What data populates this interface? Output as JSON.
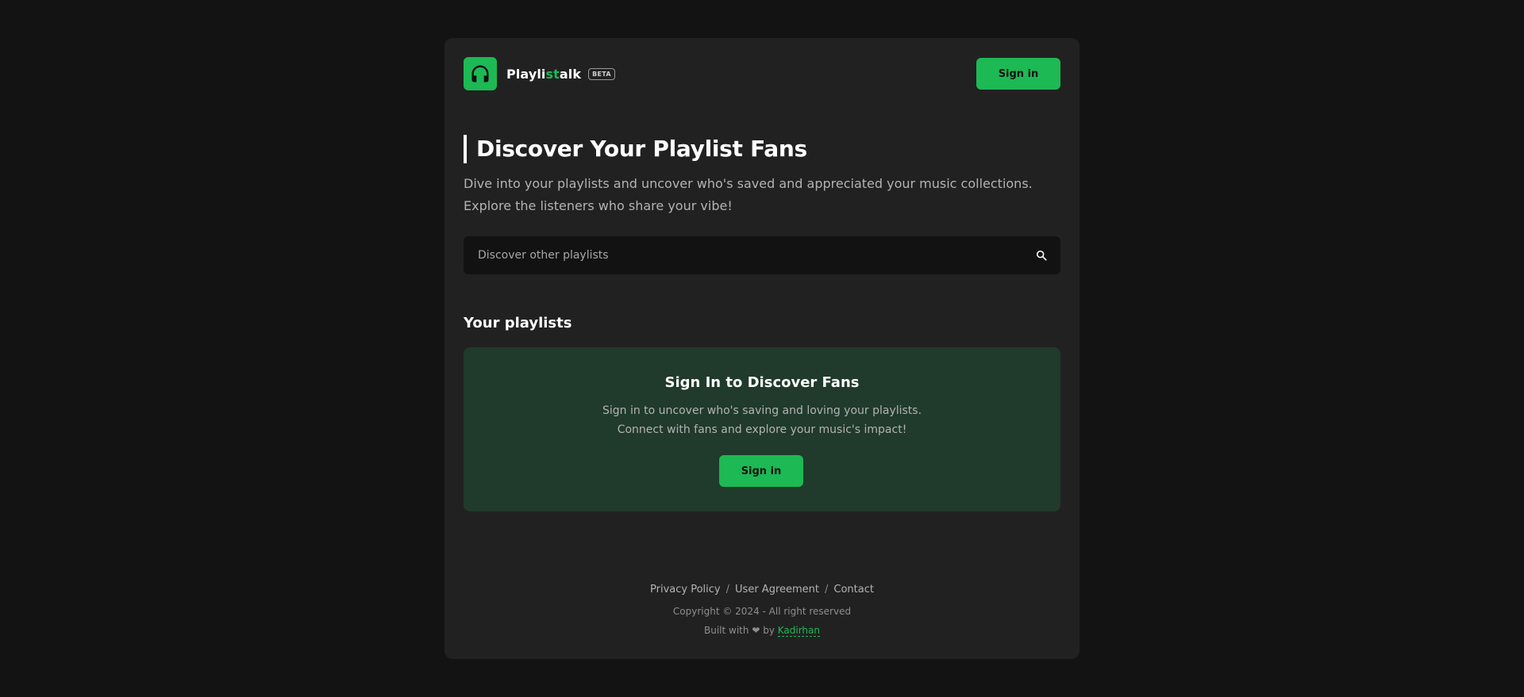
{
  "colors": {
    "page_background": "#131313",
    "card_background": "#212121",
    "accent": "#1db954",
    "panel_background": "#203a2b",
    "search_background": "#121212",
    "muted_text": "#b3b3b3"
  },
  "header": {
    "brand_prefix": "Playli",
    "brand_accent": "st",
    "brand_suffix": "alk",
    "badge": "BETA",
    "logo_icon": "headphones-icon",
    "sign_in_label": "Sign in"
  },
  "hero": {
    "title": "Discover Your Playlist Fans",
    "description_line1": "Dive into your playlists and uncover who's saved and appreciated your music collections.",
    "description_line2": "Explore the listeners who share your vibe!"
  },
  "search": {
    "placeholder": "Discover other playlists",
    "value": "",
    "icon": "search-icon"
  },
  "playlists": {
    "section_title": "Your playlists",
    "panel_title": "Sign In to Discover Fans",
    "panel_line1": "Sign in to uncover who's saving and loving your playlists.",
    "panel_line2": "Connect with fans and explore your music's impact!",
    "panel_button_label": "Sign in"
  },
  "footer": {
    "links": [
      "Privacy Policy",
      "User Agreement",
      "Contact"
    ],
    "separator": "/",
    "copyright": "Copyright © 2024 - All right reserved",
    "built_prefix": "Built with",
    "heart": "❤",
    "built_by": "by",
    "author": "Kadirhan"
  }
}
